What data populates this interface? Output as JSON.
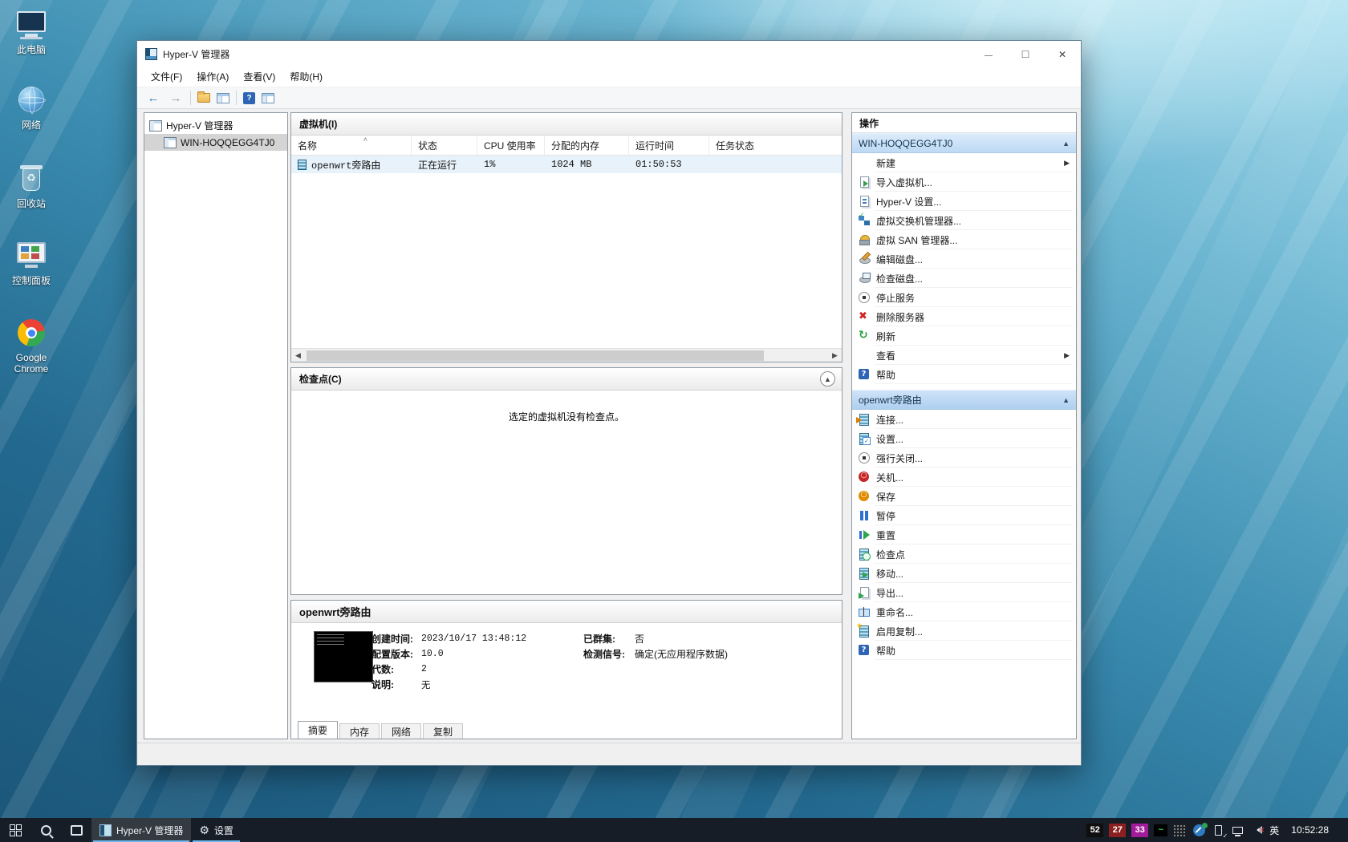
{
  "desktop": {
    "icons": [
      {
        "label": "此电脑"
      },
      {
        "label": "网络"
      },
      {
        "label": "回收站"
      },
      {
        "label": "控制面板"
      },
      {
        "label": "Google Chrome"
      }
    ]
  },
  "window": {
    "title": "Hyper-V 管理器",
    "menus": [
      "文件(F)",
      "操作(A)",
      "查看(V)",
      "帮助(H)"
    ],
    "tree": {
      "root": "Hyper-V 管理器",
      "server": "WIN-HOQQEGG4TJ0"
    },
    "vm_panel": {
      "title": "虚拟机(I)",
      "columns": [
        "名称",
        "状态",
        "CPU 使用率",
        "分配的内存",
        "运行时间",
        "任务状态"
      ],
      "rows": [
        {
          "name": "openwrt旁路由",
          "state": "正在运行",
          "cpu": "1%",
          "memory": "1024 MB",
          "uptime": "01:50:53",
          "task": ""
        }
      ]
    },
    "checkpoints": {
      "title": "检查点(C)",
      "empty_message": "选定的虚拟机没有检查点。"
    },
    "details": {
      "title": "openwrt旁路由",
      "fields_left": [
        {
          "label": "创建时间:",
          "value": "2023/10/17 13:48:12"
        },
        {
          "label": "配置版本:",
          "value": "10.0"
        },
        {
          "label": "代数:",
          "value": "2"
        },
        {
          "label": "说明:",
          "value": "无"
        }
      ],
      "fields_right": [
        {
          "label": "已群集:",
          "value": "否"
        },
        {
          "label": "检测信号:",
          "value": "确定(无应用程序数据)"
        }
      ],
      "tabs": [
        {
          "label": "摘要"
        },
        {
          "label": "内存"
        },
        {
          "label": "网络"
        },
        {
          "label": "复制"
        }
      ]
    },
    "actions": {
      "title": "操作",
      "server_section": {
        "header": "WIN-HOQQEGG4TJ0",
        "items": [
          {
            "label": "新建"
          },
          {
            "label": "导入虚拟机..."
          },
          {
            "label": "Hyper-V 设置..."
          },
          {
            "label": "虚拟交换机管理器..."
          },
          {
            "label": "虚拟 SAN 管理器..."
          },
          {
            "label": "编辑磁盘..."
          },
          {
            "label": "检查磁盘..."
          },
          {
            "label": "停止服务"
          },
          {
            "label": "删除服务器"
          },
          {
            "label": "刷新"
          },
          {
            "label": "查看"
          },
          {
            "label": "帮助"
          }
        ]
      },
      "vm_section": {
        "header": "openwrt旁路由",
        "items": [
          {
            "label": "连接..."
          },
          {
            "label": "设置..."
          },
          {
            "label": "强行关闭..."
          },
          {
            "label": "关机..."
          },
          {
            "label": "保存"
          },
          {
            "label": "暂停"
          },
          {
            "label": "重置"
          },
          {
            "label": "检查点"
          },
          {
            "label": "移动..."
          },
          {
            "label": "导出..."
          },
          {
            "label": "重命名..."
          },
          {
            "label": "启用复制..."
          },
          {
            "label": "帮助"
          }
        ]
      }
    }
  },
  "taskbar": {
    "apps": [
      {
        "label": "Hyper-V 管理器"
      },
      {
        "label": "设置"
      }
    ],
    "tray": {
      "badges": [
        {
          "text": "52",
          "bg": "#0f0f0f"
        },
        {
          "text": "27",
          "bg": "#8c1f1f"
        },
        {
          "text": "33",
          "bg": "#a21b9a"
        }
      ],
      "ime": "英",
      "time": "10:52:28"
    }
  }
}
